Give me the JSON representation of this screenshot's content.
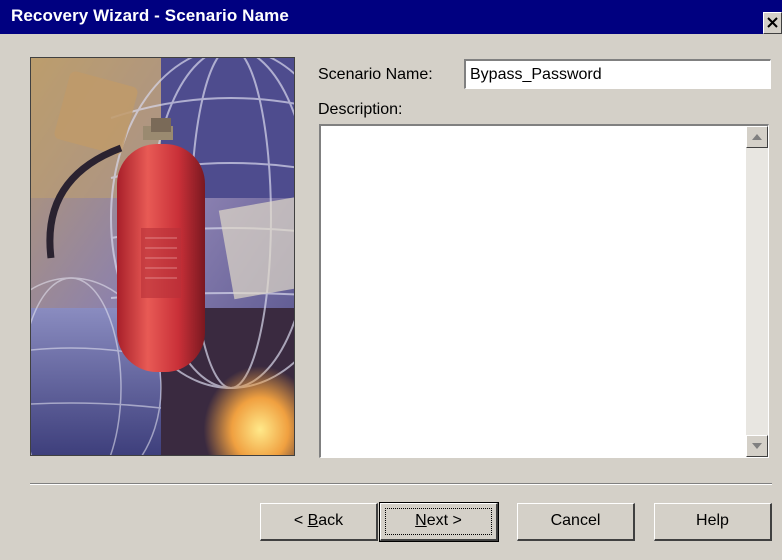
{
  "window": {
    "title": "Recovery Wizard - Scenario Name",
    "close_icon": "close-icon"
  },
  "picture": {
    "icon": "fire-extinguisher-illustration"
  },
  "form": {
    "name_label": "Scenario Name:",
    "name_value": "Bypass_Password",
    "description_label": "Description:",
    "description_value": ""
  },
  "buttons": {
    "back_prefix": "< ",
    "back_key": "B",
    "back_rest": "ack",
    "next_key": "N",
    "next_rest": "ext >",
    "cancel": "Cancel",
    "help": "Help"
  },
  "colors": {
    "title_bar": "#000080",
    "dialog_bg": "#d4d0c8"
  }
}
